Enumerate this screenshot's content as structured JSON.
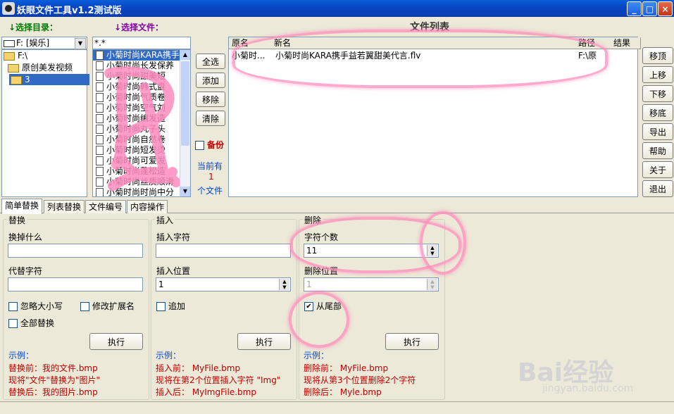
{
  "window": {
    "title": "妖眼文件工具v1.2测试版",
    "minimize": "_",
    "maximize": "□",
    "close": "×"
  },
  "left": {
    "dir_label": "↓选择目录：",
    "drive": "F: [娱乐]",
    "tree": [
      "F:\\",
      "原创美发视频",
      "3"
    ]
  },
  "files": {
    "label": "↓选择文件：",
    "filter": "*.*",
    "items": [
      "小菊时尚KARA携手",
      "小菊时尚长发保养",
      "小菊时尚甜美短",
      "小菊时尚韩式盘",
      "小菊时尚气质卷",
      "小菊时尚空气刘",
      "小菊时尚编发造",
      "小菊时尚丸子头",
      "小菊时尚自然卷",
      "小菊时尚短发烫",
      "小菊时尚可爱发",
      "小菊时尚蓬松造",
      "小菊时尚丝质顺滑",
      "小菊时尚时尚中分"
    ]
  },
  "mid_buttons": {
    "select_all": "全选",
    "add": "添加",
    "remove": "移除",
    "clear": "清除",
    "backup": "备份",
    "current_prefix": "当前有",
    "count": "1",
    "count_suffix": "个文件"
  },
  "filelist": {
    "title": "文件列表",
    "columns": [
      "原名",
      "新名",
      "路径",
      "结果"
    ],
    "rows": [
      {
        "old": "小菊时...",
        "new": "小菊时尚KARA携手益若翼甜美代言.flv",
        "path": "F:\\原",
        "result": ""
      }
    ]
  },
  "side_buttons": [
    "移顶",
    "上移",
    "下移",
    "移底",
    "导出",
    "帮助",
    "关于",
    "退出"
  ],
  "tabs": [
    "简单替换",
    "列表替换",
    "文件编号",
    "内容操作"
  ],
  "replace": {
    "legend": "替换",
    "what_label": "换掉什么",
    "with_label": "代替字符",
    "ignore_case": "忽略大小写",
    "modify_ext": "修改扩展名",
    "replace_all": "全部替换",
    "exec": "执行",
    "example_title": "示例：",
    "ex1": "替换前：我的文件.bmp",
    "ex2": "现将\"文件\"替换为\"图片\"",
    "ex3": "替换后：我的图片.bmp"
  },
  "insert": {
    "legend": "插入",
    "chars_label": "插入字符",
    "pos_label": "插入位置",
    "pos_value": "1",
    "append": "追加",
    "exec": "执行",
    "example_title": "示例：",
    "ex1": "插入前：  MyFile.bmp",
    "ex2": "现将在第2个位置插入字符 \"Img\"",
    "ex3": "插入后：  MyImgFile.bmp"
  },
  "delete": {
    "legend": "删除",
    "count_label": "字符个数",
    "count_value": "11",
    "pos_label": "删除位置",
    "pos_value": "1",
    "from_end": "从尾部",
    "exec": "执行",
    "example_title": "示例：",
    "ex1": "删除前：  MyFile.bmp",
    "ex2": "现将从第3个位置删除2个字符",
    "ex3": "删除后：  Myle.bmp"
  },
  "watermark": {
    "brand": "Bai经验",
    "url": "jingyan.baidu.com"
  }
}
